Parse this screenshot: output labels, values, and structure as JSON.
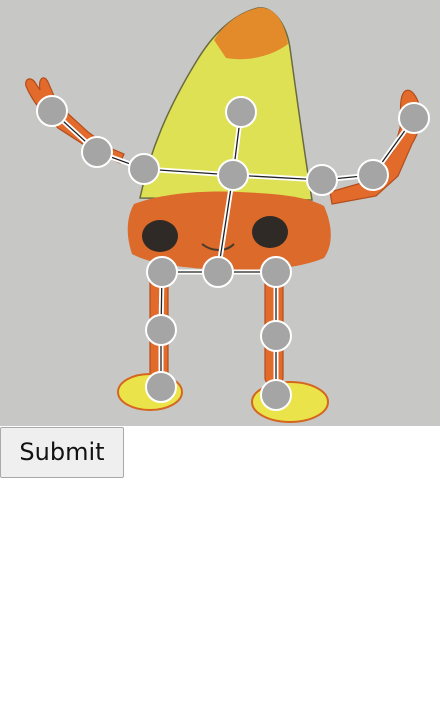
{
  "submit": {
    "label": "Submit"
  },
  "colors": {
    "canvas_bg": "#c7c7c5",
    "joint_fill": "#a5a5a5",
    "joint_stroke": "#ffffff",
    "bone_outer": "#ffffff",
    "bone_inner": "#222222",
    "body_yellow": "#dfe154",
    "tip_orange": "#e38a2b",
    "lower_orange": "#dc6a2a",
    "limb_orange": "#e26a2b",
    "feet_yellow": "#ebe34a"
  },
  "skeleton": {
    "joints": [
      {
        "id": "head"
      },
      {
        "id": "neck"
      },
      {
        "id": "left-shoulder"
      },
      {
        "id": "left-elbow"
      },
      {
        "id": "left-hand"
      },
      {
        "id": "right-shoulder"
      },
      {
        "id": "right-elbow"
      },
      {
        "id": "right-hand"
      },
      {
        "id": "hip"
      },
      {
        "id": "left-hip"
      },
      {
        "id": "left-knee"
      },
      {
        "id": "left-foot"
      },
      {
        "id": "right-hip"
      },
      {
        "id": "right-knee"
      },
      {
        "id": "right-foot"
      }
    ],
    "bones": [
      [
        "neck",
        "head"
      ],
      [
        "neck",
        "left-shoulder"
      ],
      [
        "left-shoulder",
        "left-elbow"
      ],
      [
        "left-elbow",
        "left-hand"
      ],
      [
        "neck",
        "right-shoulder"
      ],
      [
        "right-shoulder",
        "right-elbow"
      ],
      [
        "right-elbow",
        "right-hand"
      ],
      [
        "neck",
        "hip"
      ],
      [
        "hip",
        "left-hip"
      ],
      [
        "left-hip",
        "left-knee"
      ],
      [
        "left-knee",
        "left-foot"
      ],
      [
        "hip",
        "right-hip"
      ],
      [
        "right-hip",
        "right-knee"
      ],
      [
        "right-knee",
        "right-foot"
      ]
    ]
  }
}
